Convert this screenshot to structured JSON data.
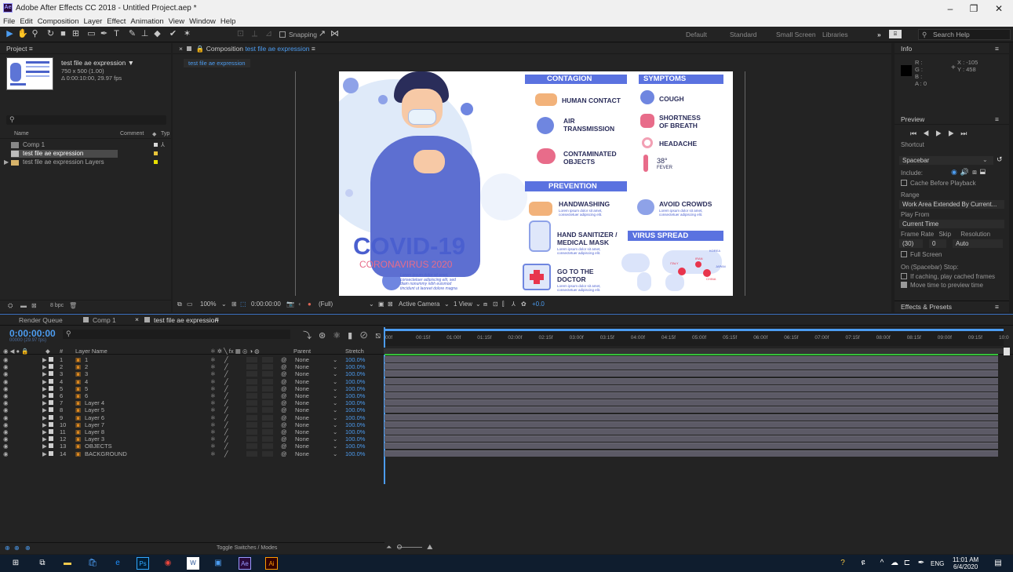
{
  "window": {
    "title": "Adobe After Effects CC 2018 - Untitled Project.aep *",
    "app_icon": "Ae"
  },
  "menu": [
    "File",
    "Edit",
    "Composition",
    "Layer",
    "Effect",
    "Animation",
    "View",
    "Window",
    "Help"
  ],
  "toolbar": {
    "snapping_label": "Snapping",
    "workspaces": [
      "Default",
      "Standard",
      "Small Screen",
      "Libraries"
    ],
    "search_placeholder": "Search Help"
  },
  "project": {
    "title": "Project",
    "comp_name": "test file ae expression",
    "comp_dims": "750 x 500 (1.00)",
    "comp_duration": "Δ 0:00:10:00, 29.97 fps",
    "search_placeholder": "",
    "columns": {
      "name": "Name",
      "comment": "Comment",
      "type": "Typ"
    },
    "items": [
      {
        "name": "Comp 1",
        "color": "#d8d8d8"
      },
      {
        "name": "test file ae expression",
        "color": "#e8c43a"
      },
      {
        "name": "test file ae expression Layers",
        "color": "#e8e000"
      }
    ],
    "bpc": "8 bpc"
  },
  "composition": {
    "header_prefix": "Composition",
    "name": "test file ae expression",
    "tab": "test file ae expression",
    "zoom": "100%",
    "timecode": "0:00:00:00",
    "resolution": "(Full)",
    "camera": "Active Camera",
    "view": "1 View",
    "exposure": "+0.0"
  },
  "infographic": {
    "contagion": "CONTAGION",
    "symptoms": "SYMPTOMS",
    "human_contact": "HUMAN CONTACT",
    "air_1": "AIR",
    "air_2": "TRANSMISSION",
    "contaminated_1": "CONTAMINATED",
    "contaminated_2": "OBJECTS",
    "cough": "COUGH",
    "shortness_1": "SHORTNESS",
    "shortness_2": "OF BREATH",
    "headache": "HEADACHE",
    "fever_temp": "38°",
    "fever": "FEVER",
    "prevention": "PREVENTION",
    "handwashing": "HANDWASHING",
    "avoid_crowds": "AVOID CROWDS",
    "sanitizer_1": "HAND SANITIZER /",
    "sanitizer_2": "MEDICAL MASK",
    "virus_spread": "VIRUS SPREAD",
    "doctor_1": "GO TO THE",
    "doctor_2": "DOCTOR",
    "lorem_1": "Lorem ipsum dolor sit amet,",
    "lorem_2": "consectetuer adipiscing elit.",
    "covid": "COVID-19",
    "corona": "CORONAVIRUS 2020",
    "body_1": "Lorem ipsum dolor sit amet,",
    "body_2": "consectetuer adipiscing elit, sed",
    "body_3": "diam nonummy nibh euismod",
    "body_4": "tincidunt ut laoreet dolore magna",
    "map_labels": [
      "IRAN",
      "ITALY",
      "CHINA",
      "JAPAN",
      "KOREA"
    ]
  },
  "info": {
    "title": "Info",
    "r": "R :",
    "g": "G :",
    "b": "B :",
    "a": "A : 0",
    "x": "X : -105",
    "y": "Y : 458"
  },
  "preview": {
    "title": "Preview",
    "shortcut_label": "Shortcut",
    "shortcut_value": "Spacebar",
    "include_label": "Include:",
    "cache_before": "Cache Before Playback",
    "range_label": "Range",
    "range_value": "Work Area Extended By Current...",
    "play_from_label": "Play From",
    "play_from_value": "Current Time",
    "frame_rate_label": "Frame Rate",
    "skip_label": "Skip",
    "resolution_label": "Resolution",
    "frame_rate_value": "(30)",
    "skip_value": "0",
    "resolution_value": "Auto",
    "full_screen": "Full Screen",
    "on_stop": "On (Spacebar) Stop:",
    "if_caching": "If caching, play cached frames",
    "move_time": "Move time to preview time"
  },
  "effects": {
    "title": "Effects & Presets"
  },
  "timeline": {
    "tabs": [
      "Render Queue",
      "Comp 1",
      "test file ae expression"
    ],
    "timecode": "0:00:00:00",
    "frames": "00000 (29.97 fps)",
    "col_layer_name": "Layer Name",
    "col_parent": "Parent",
    "col_stretch": "Stretch",
    "ticks": [
      "00f",
      "00:15f",
      "01:00f",
      "01:15f",
      "02:00f",
      "02:15f",
      "03:00f",
      "03:15f",
      "04:00f",
      "04:15f",
      "05:00f",
      "05:15f",
      "06:00f",
      "06:15f",
      "07:00f",
      "07:15f",
      "08:00f",
      "08:15f",
      "09:00f",
      "09:15f",
      "10:0"
    ],
    "toggle_label": "Toggle Switches / Modes",
    "layers": [
      {
        "num": "1",
        "name": "1",
        "parent": "None",
        "stretch": "100.0%"
      },
      {
        "num": "2",
        "name": "2",
        "parent": "None",
        "stretch": "100.0%"
      },
      {
        "num": "3",
        "name": "3",
        "parent": "None",
        "stretch": "100.0%"
      },
      {
        "num": "4",
        "name": "4",
        "parent": "None",
        "stretch": "100.0%"
      },
      {
        "num": "5",
        "name": "5",
        "parent": "None",
        "stretch": "100.0%"
      },
      {
        "num": "6",
        "name": "6",
        "parent": "None",
        "stretch": "100.0%"
      },
      {
        "num": "7",
        "name": "Layer 4",
        "parent": "None",
        "stretch": "100.0%"
      },
      {
        "num": "8",
        "name": "Layer 5",
        "parent": "None",
        "stretch": "100.0%"
      },
      {
        "num": "9",
        "name": "Layer 6",
        "parent": "None",
        "stretch": "100.0%"
      },
      {
        "num": "10",
        "name": "Layer 7",
        "parent": "None",
        "stretch": "100.0%"
      },
      {
        "num": "11",
        "name": "Layer 8",
        "parent": "None",
        "stretch": "100.0%"
      },
      {
        "num": "12",
        "name": "Layer 3",
        "parent": "None",
        "stretch": "100.0%"
      },
      {
        "num": "13",
        "name": "OBJECTS",
        "parent": "None",
        "stretch": "100.0%"
      },
      {
        "num": "14",
        "name": "BACKGROUND",
        "parent": "None",
        "stretch": "100.0%"
      }
    ]
  },
  "taskbar": {
    "time": "11:01 AM",
    "date": "6/4/2020",
    "lang": "ENG",
    "apps": [
      "Ps",
      "Ae",
      "Ai"
    ]
  }
}
